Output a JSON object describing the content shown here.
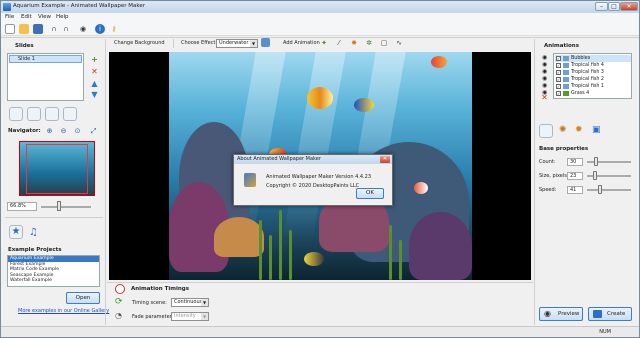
{
  "window": {
    "title": "Aquarium Example - Animated Wallpaper Maker",
    "min_glyph": "–",
    "max_glyph": "□",
    "close_glyph": "✕"
  },
  "menu": [
    "File",
    "Edit",
    "View",
    "Help"
  ],
  "toolbar2": {
    "change_background": "Change Background",
    "choose_effect_label": "Choose Effect:",
    "effect_value": "Underwater",
    "add_animation": "Add Animation"
  },
  "slides": {
    "title": "Slides",
    "items": [
      "Slide 1"
    ]
  },
  "navigator": {
    "title": "Navigator:",
    "zoom_value": "66.8%"
  },
  "example_projects": {
    "title": "Example Projects",
    "items": [
      "Aquarium Example",
      "Forest Example",
      "Matrix Code Example",
      "Seascape Example",
      "Waterfall Example"
    ],
    "open_label": "Open",
    "gallery_link": "More examples in our Online Gallery"
  },
  "dialog": {
    "title": "About Animated Wallpaper Maker",
    "version": "Animated Wallpaper Maker Version 4.4.23",
    "copyright": "Copyright © 2020 DesktopPaints LLC",
    "ok_label": "OK"
  },
  "animations": {
    "title": "Animations",
    "items": [
      "Bubbles",
      "Tropical fish 4",
      "Tropical fish 3",
      "Tropical fish 2",
      "Tropical fish 1",
      "Grass 4"
    ]
  },
  "base_properties": {
    "title": "Base properties",
    "count_label": "Count:",
    "count_value": "30",
    "count_level": 0.18,
    "size_label": "Size, pixels:",
    "size_value": "23",
    "size_level": 0.16,
    "speed_label": "Speed:",
    "speed_value": "41",
    "speed_level": 0.28
  },
  "timings": {
    "title": "Animation Timings",
    "timing_scene_label": "Timing scene:",
    "timing_scene_value": "Continuous",
    "fade_label": "Fade parameter:",
    "fade_value": "Intensity"
  },
  "actions": {
    "preview": "Preview",
    "create": "Create"
  },
  "status": {
    "num": "NUM"
  }
}
